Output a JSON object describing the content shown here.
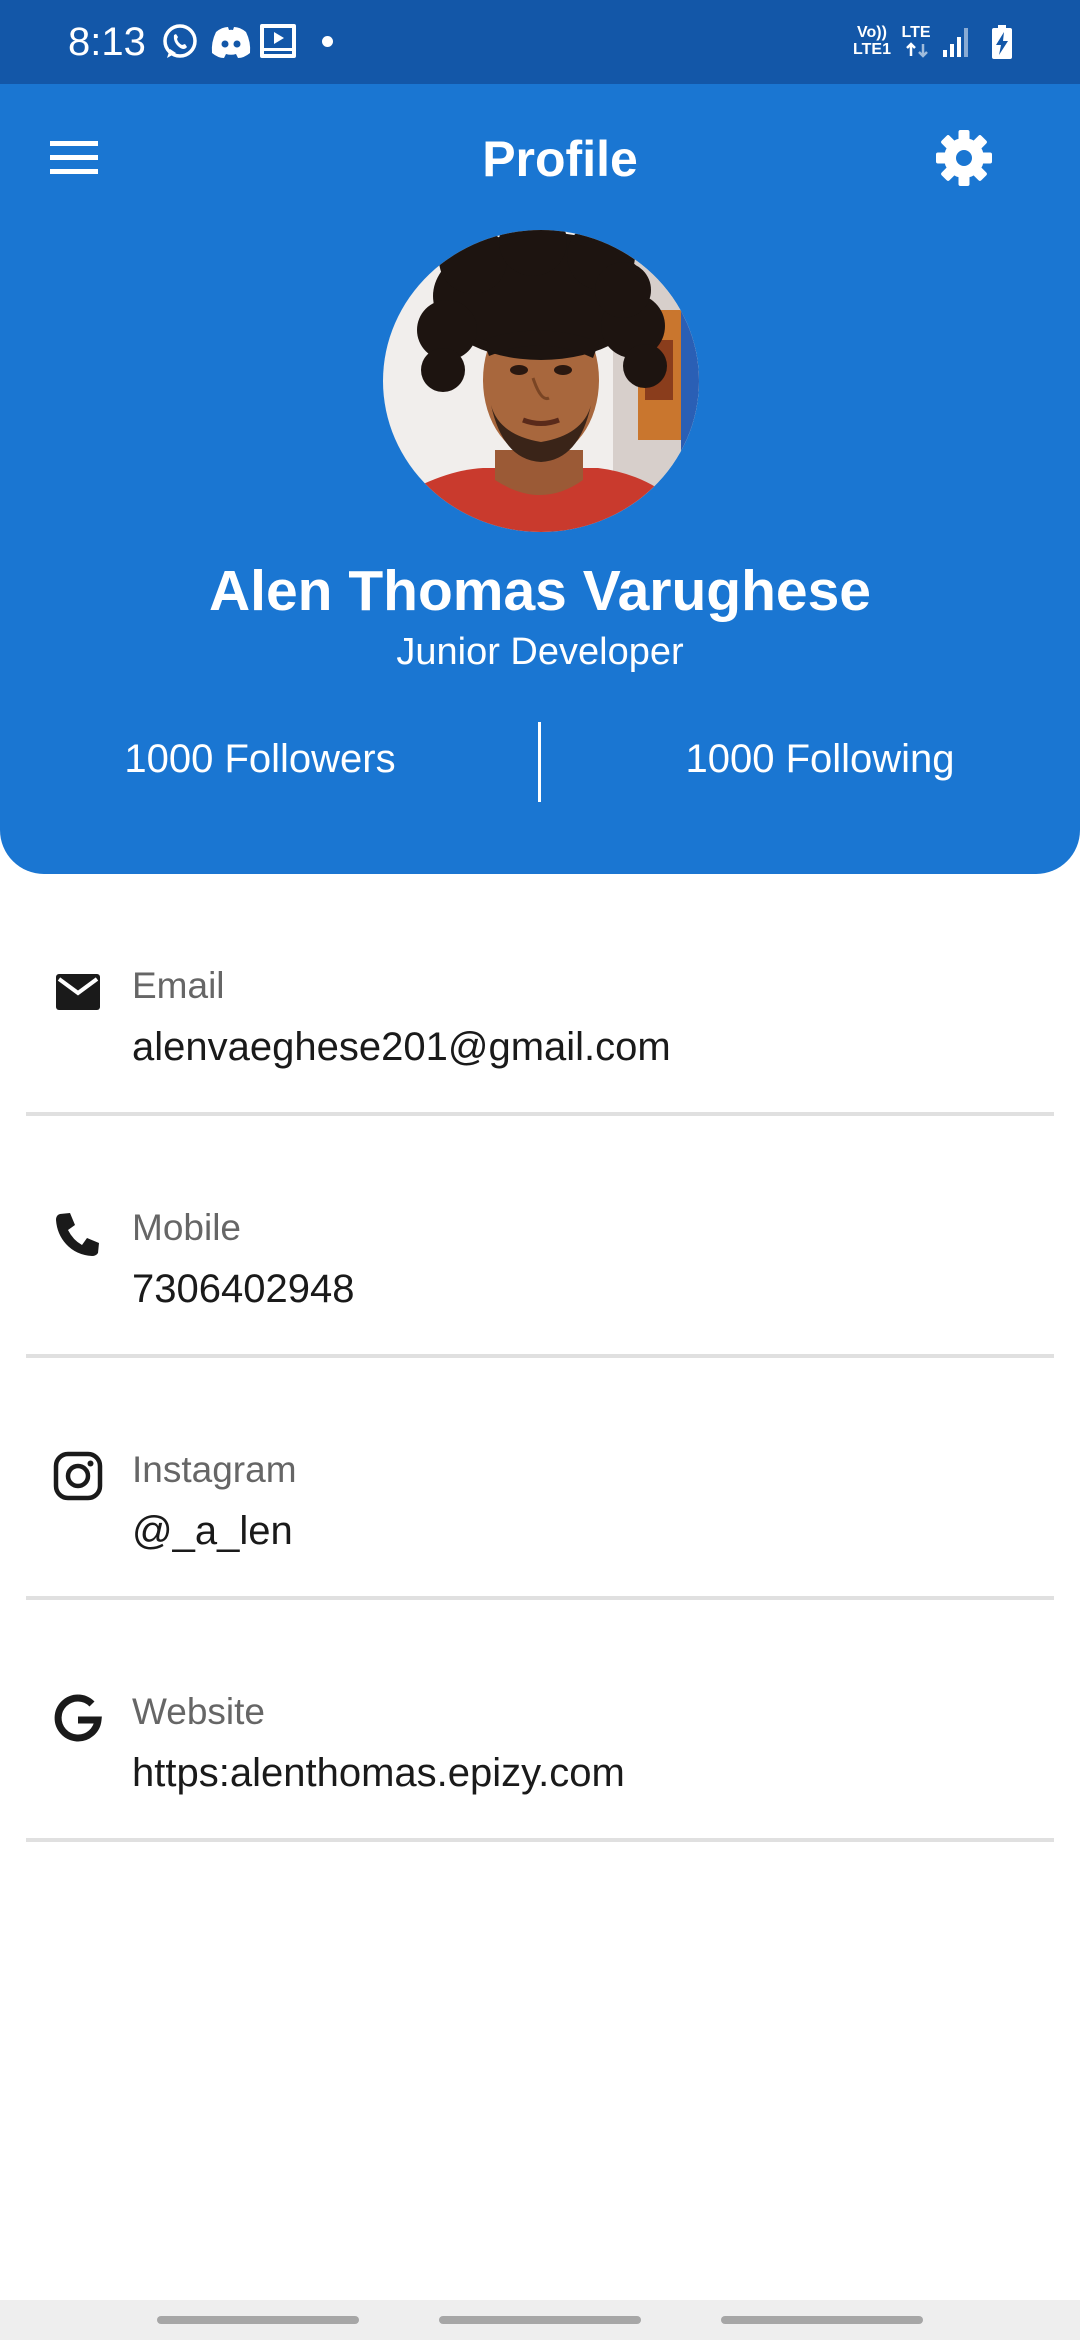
{
  "status_bar": {
    "time": "8:13",
    "network_top": "Vo))",
    "network_bottom": "LTE1",
    "network_type": "LTE",
    "icons": [
      "whatsapp-icon",
      "discord-icon",
      "youtube-icon",
      "signal-icon",
      "battery-charging-icon"
    ]
  },
  "header": {
    "title": "Profile",
    "background_color": "#1a76d2",
    "menu_icon": "hamburger-menu-icon",
    "settings_icon": "gear-icon"
  },
  "profile": {
    "name": "Alen Thomas Varughese",
    "role": "Junior Developer",
    "followers": "1000 Followers",
    "following": "1000 Following"
  },
  "info_items": [
    {
      "icon": "email-icon",
      "label": "Email",
      "value": "alenvaeghese201@gmail.com"
    },
    {
      "icon": "phone-icon",
      "label": "Mobile",
      "value": "7306402948"
    },
    {
      "icon": "instagram-icon",
      "label": "Instagram",
      "value": "@_a_len"
    },
    {
      "icon": "google-icon",
      "label": "Website",
      "value": "https:alenthomas.epizy.com"
    }
  ]
}
